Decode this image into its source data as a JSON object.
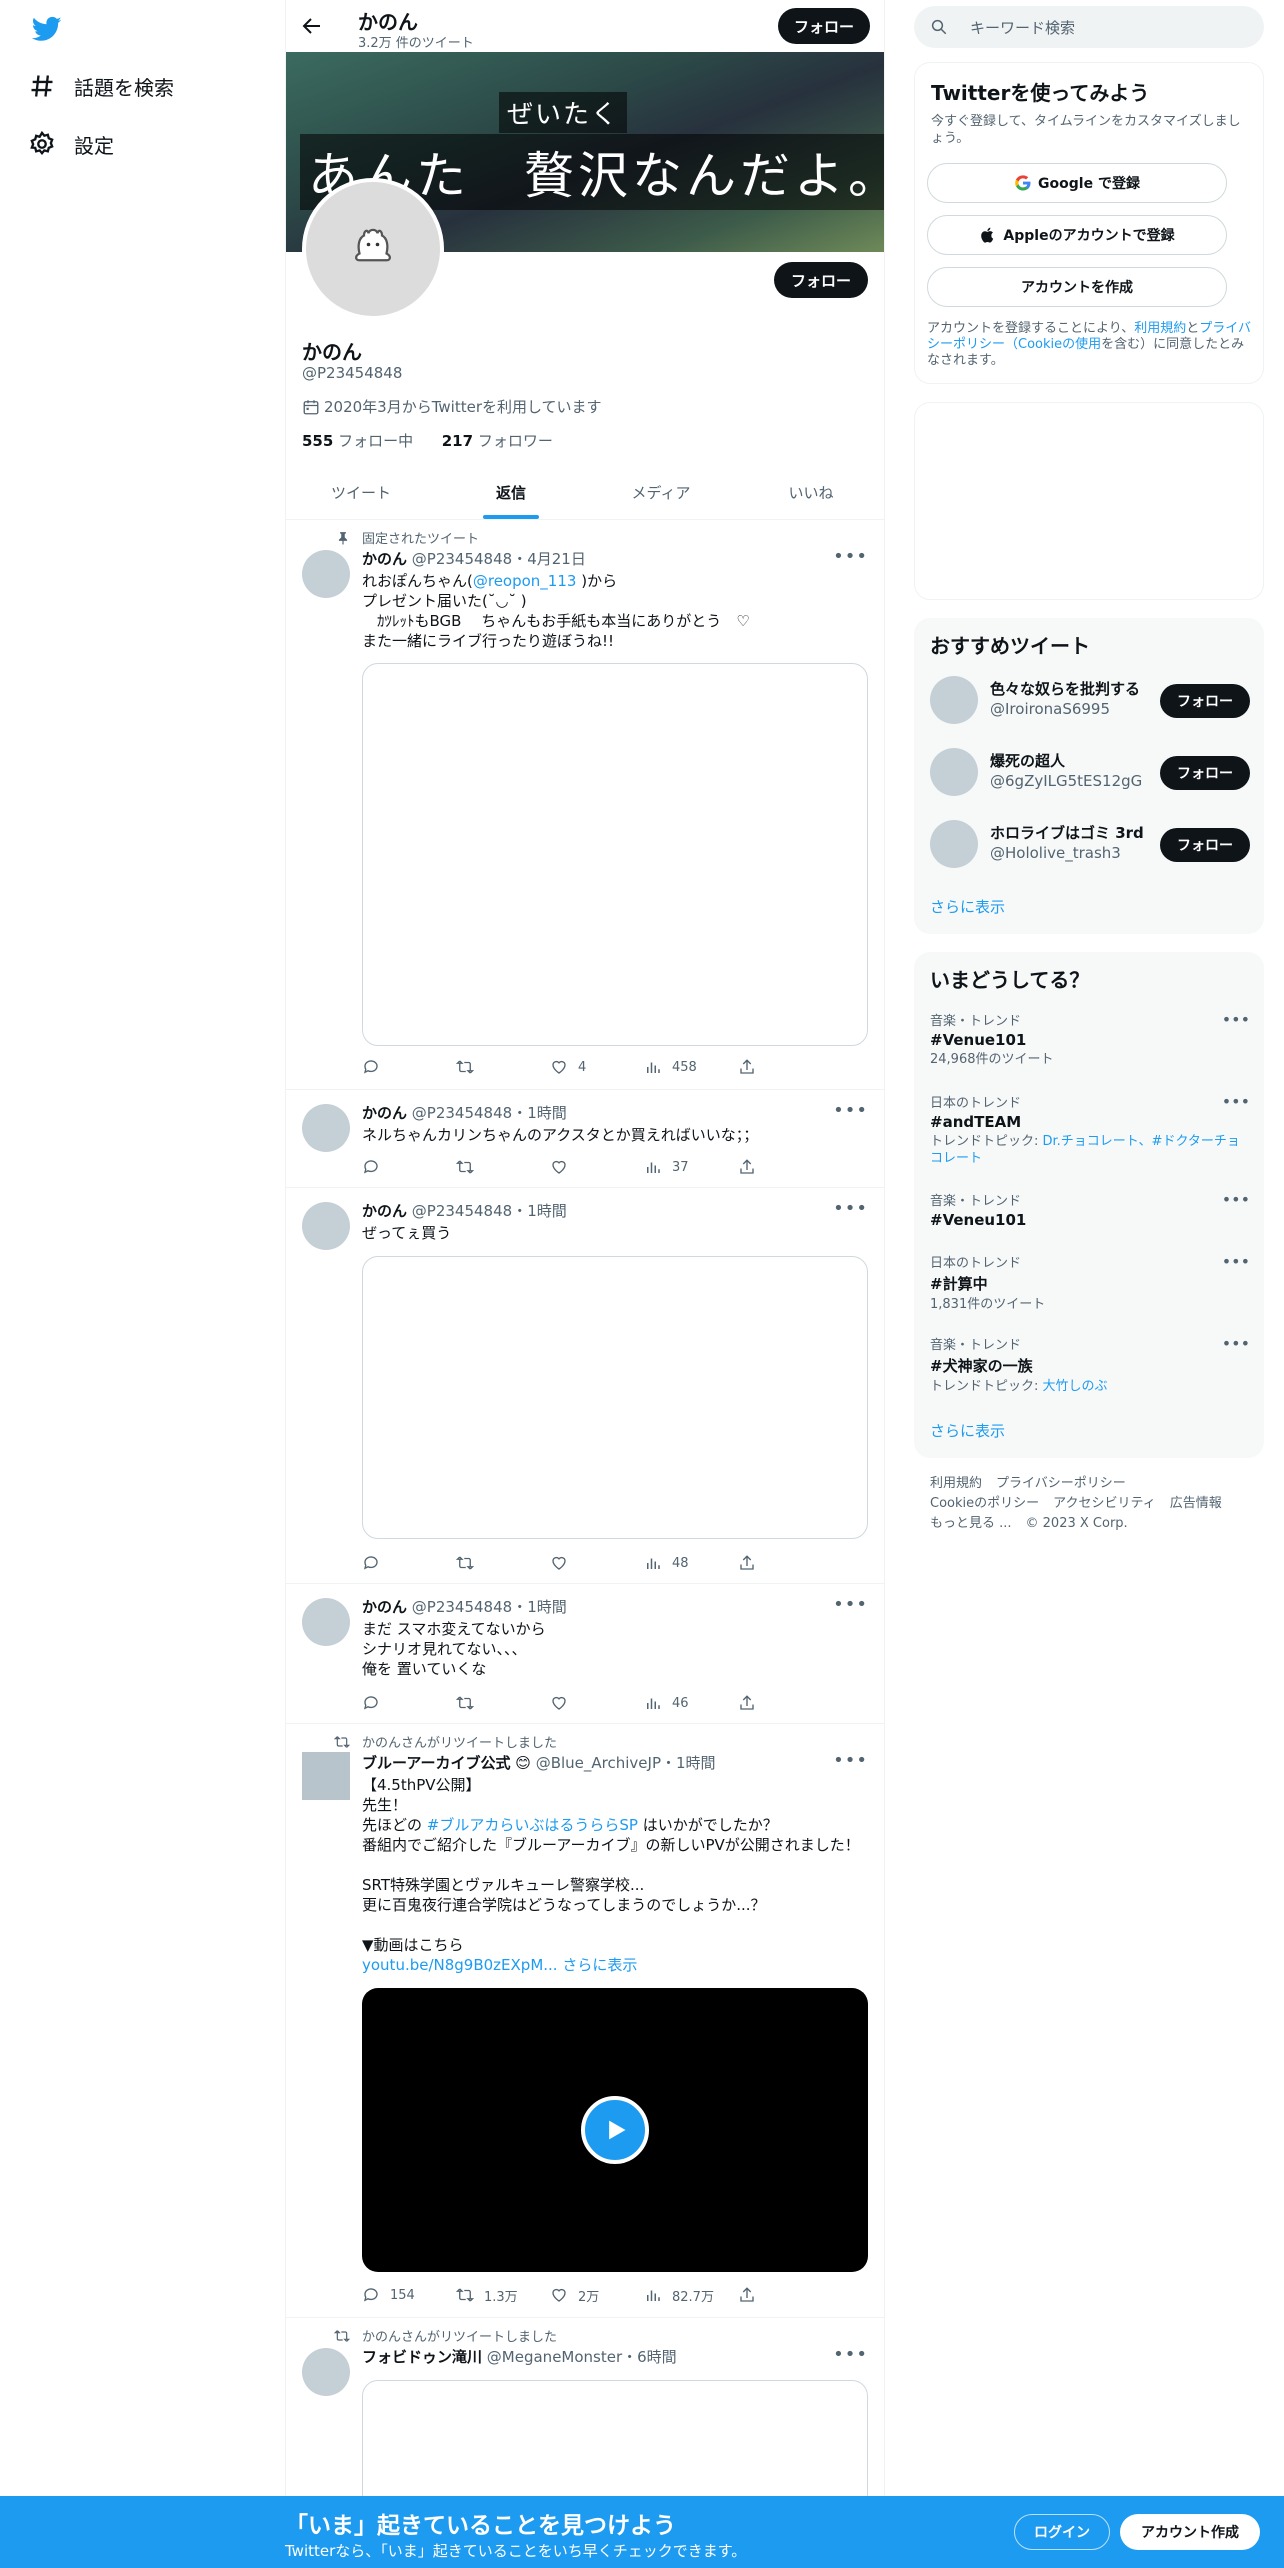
{
  "nav": {
    "explore_label": "話題を検索",
    "settings_label": "設定"
  },
  "header": {
    "name": "かのん",
    "tweet_count": "3.2万 件のツイート",
    "follow_label": "フォロー"
  },
  "banner": {
    "ruby": "ぜいたく",
    "caption": "あんた　贅沢なんだよ。"
  },
  "profile": {
    "follow_label": "フォロー",
    "name": "かのん",
    "handle": "@P23454848",
    "joined": "2020年3月からTwitterを利用しています",
    "following_count": "555",
    "following_label": "フォロー中",
    "followers_count": "217",
    "followers_label": "フォロワー"
  },
  "tabs": [
    "ツイート",
    "返信",
    "メディア",
    "いいね"
  ],
  "active_tab": "返信",
  "tweets": [
    {
      "pinned_label": "固定されたツイート",
      "name": "かのん",
      "handle": "@P23454848",
      "time": "・4月21日",
      "text_pre": "れおぽんちゃん(",
      "mention": "@reopon_113",
      "text_post": " )から\nプレゼント届いた(˘◡˘ )\n　ｶﾂﾚｯﾄもBGB　 ちゃんもお手紙も本当にありがとう　♡\nまた一緒にライブ行ったり遊ぼうね!!",
      "reply": "",
      "retweet": "",
      "like": "4",
      "views": "458"
    },
    {
      "name": "かのん",
      "handle": "@P23454848",
      "time": "・1時間",
      "text": "ネルちゃんカリンちゃんのアクスタとか買えればいいな；；",
      "reply": "",
      "retweet": "",
      "like": "",
      "views": "37"
    },
    {
      "name": "かのん",
      "handle": "@P23454848",
      "time": "・1時間",
      "text": "ぜってぇ買う",
      "reply": "",
      "retweet": "",
      "like": "",
      "views": "48"
    },
    {
      "name": "かのん",
      "handle": "@P23454848",
      "time": "・1時間",
      "text": "まだ スマホ変えてないから\nシナリオ見れてない、、、\n俺を 置いていくな",
      "reply": "",
      "retweet": "",
      "like": "",
      "views": "46"
    },
    {
      "retweeted_label": "かのんさんがリツイートしました",
      "name": "ブルーアーカイブ公式",
      "badge": "😊",
      "handle": "@Blue_ArchiveJP",
      "time": "・1時間",
      "line1": "【4.5thPV公開】",
      "line2": "先生！",
      "line3_pre": "先ほどの ",
      "line3_tag": "#ブルアカらいぶはるうららSP",
      "line3_post": " はいかがでしたか？",
      "line4": "番組内でご紹介した『ブルーアーカイブ』の新しいPVが公開されました！",
      "line5": "SRT特殊学園とヴァルキューレ警察学校...",
      "line6": "更に百鬼夜行連合学院はどうなってしまうのでしょうか...？",
      "line7": "▼動画はこちら",
      "link": "youtu.be/N8g9B0zEXpM...",
      "show_more": "さらに表示",
      "reply": "154",
      "retweet": "1.3万",
      "like": "2万",
      "views": "82.7万"
    },
    {
      "retweeted_label": "かのんさんがリツイートしました",
      "name": "フォビドゥン滝川",
      "handle": "@MeganeMonster",
      "time": "・6時間"
    }
  ],
  "search": {
    "placeholder": "キーワード検索"
  },
  "signup": {
    "title": "Twitterを使ってみよう",
    "desc": "今すぐ登録して、タイムラインをカスタマイズしましょう。",
    "google": "Google で登録",
    "apple": "Appleのアカウントで登録",
    "create": "アカウントを作成",
    "legal_pre": "アカウントを登録することにより、",
    "legal_terms": "利用規約",
    "legal_and": "と",
    "legal_privacy": "プライバシーポリシー（Cookieの使用",
    "legal_post": "を含む）に同意したとみなされます。"
  },
  "recommend": {
    "title": "おすすめツイート",
    "users": [
      {
        "name": "色々な奴らを批判する",
        "handle": "@IroironaS6995",
        "follow": "フォロー"
      },
      {
        "name": "爆死の超人",
        "handle": "@6gZyILG5tES12gG",
        "follow": "フォロー"
      },
      {
        "name": "ホロライブはゴミ 3rd",
        "handle": "@Hololive_trash3",
        "follow": "フォロー"
      }
    ],
    "show_more": "さらに表示"
  },
  "trends": {
    "title": "いまどうしてる？",
    "items": [
      {
        "context": "音楽・トレンド",
        "name": "#Venue101",
        "sub": "24,968件のツイート"
      },
      {
        "context": "日本のトレンド",
        "name": "#andTEAM",
        "sub_label": "トレンドトピック: ",
        "sub_link": "Dr.チョコレート、#ドクターチョコレート"
      },
      {
        "context": "音楽・トレンド",
        "name": "#Veneu101"
      },
      {
        "context": "日本のトレンド",
        "name": "#計算中",
        "sub": "1,831件のツイート"
      },
      {
        "context": "音楽・トレンド",
        "name": "#犬神家の一族",
        "sub_label": "トレンドトピック: ",
        "sub_link": "大竹しのぶ"
      }
    ],
    "show_more": "さらに表示"
  },
  "footer": {
    "terms": "利用規約",
    "privacy": "プライバシーポリシー",
    "cookie": "Cookieのポリシー",
    "accessibility": "アクセシビリティ",
    "ads": "広告情報",
    "more": "もっと見る ...",
    "copyright": "© 2023 X Corp."
  },
  "bottom_bar": {
    "title": "「いま」起きていることを見つけよう",
    "subtitle": "Twitterなら、「いま」起きていることをいち早くチェックできます。",
    "login": "ログイン",
    "signup": "アカウント作成"
  },
  "colors": {
    "accent": "#1d9bf0",
    "text": "#0f1419",
    "muted": "#536471"
  }
}
